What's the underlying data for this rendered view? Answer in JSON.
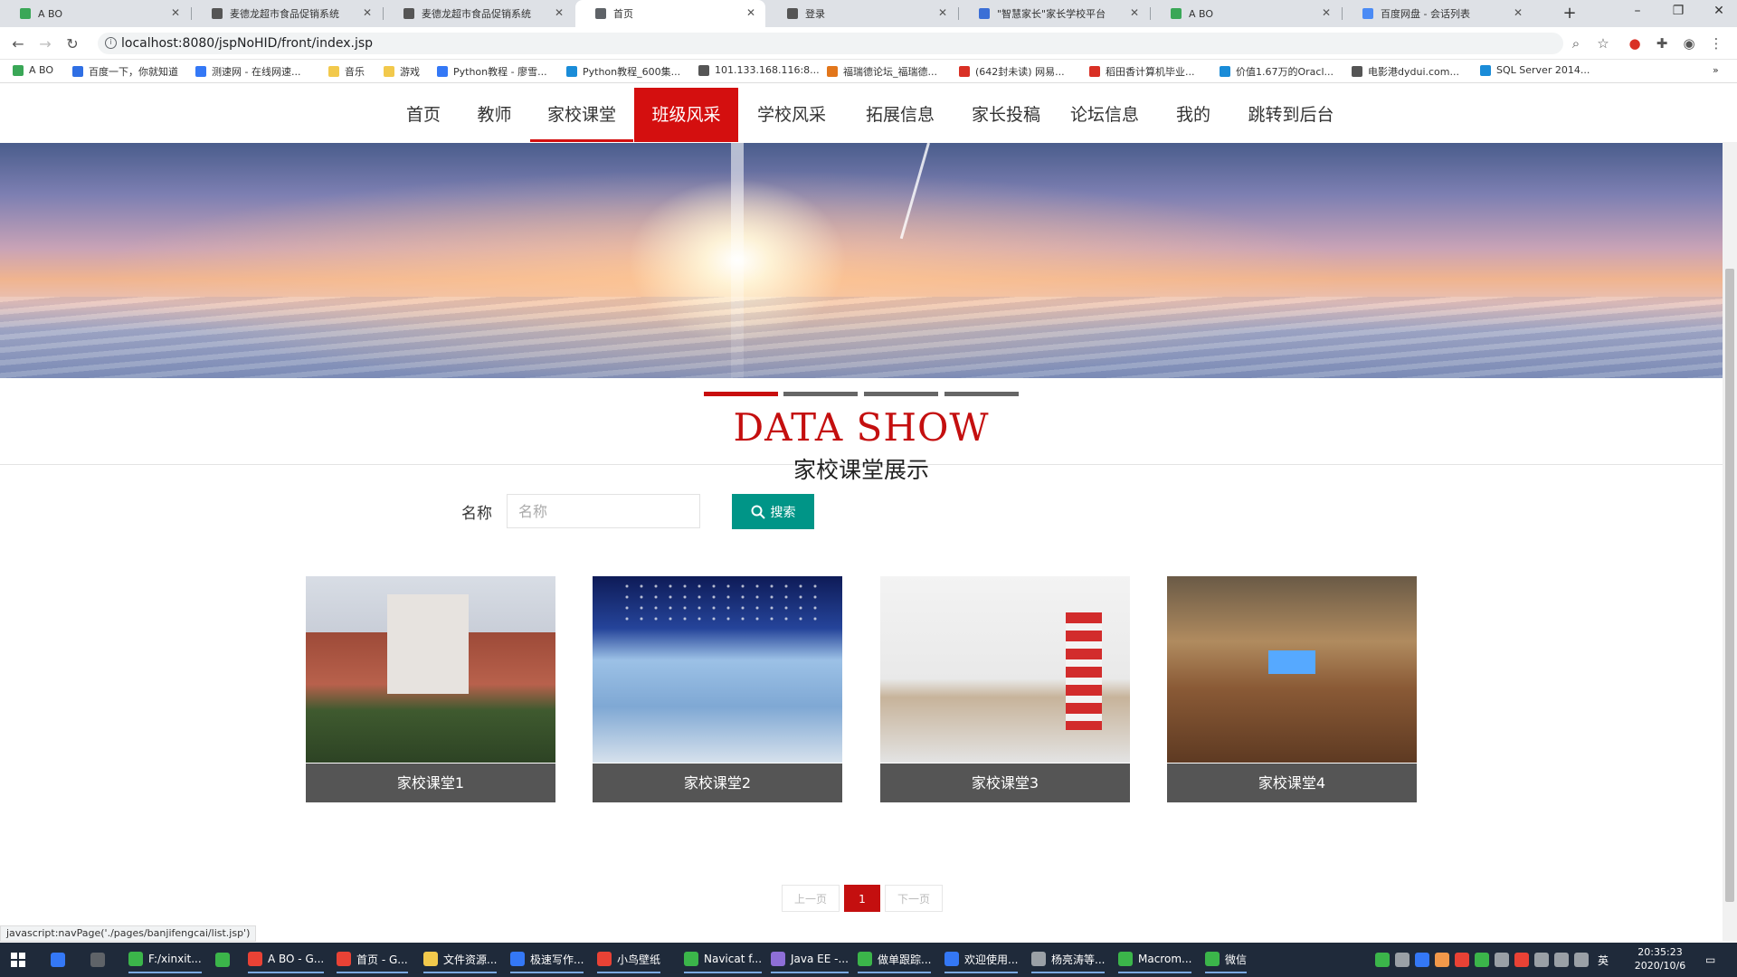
{
  "browser": {
    "tabs": [
      {
        "title": "A BO",
        "icon": "leaf-icon",
        "color": "#3aa757"
      },
      {
        "title": "麦德龙超市食品促销系统",
        "icon": "cart-icon",
        "color": "#555555"
      },
      {
        "title": "麦德龙超市食品促销系统",
        "icon": "cart-icon",
        "color": "#555555"
      },
      {
        "title": "首页",
        "icon": "globe-icon",
        "color": "#5f6368",
        "active": true
      },
      {
        "title": "登录",
        "icon": "login-icon",
        "color": "#555555"
      },
      {
        "title": "\"智慧家长\"家长学校平台",
        "icon": "shield-icon",
        "color": "#3b6fd6"
      },
      {
        "title": "A BO",
        "icon": "leaf-icon",
        "color": "#3aa757"
      },
      {
        "title": "百度网盘 - 会话列表",
        "icon": "cloud-icon",
        "color": "#4b8bf5"
      }
    ],
    "url": "localhost:8080/jspNoHID/front/index.jsp",
    "bookmarks": [
      {
        "label": "A BO",
        "color": "#3aa757"
      },
      {
        "label": "百度一下，你就知道",
        "color": "#2f6fe4"
      },
      {
        "label": "测速网 - 在线网速...",
        "color": "#3478f6"
      },
      {
        "label": "音乐",
        "color": "#f2c94c"
      },
      {
        "label": "游戏",
        "color": "#f2c94c"
      },
      {
        "label": "Python教程 - 廖雪...",
        "color": "#3478f6"
      },
      {
        "label": "Python教程_600集...",
        "color": "#1a8cd8"
      },
      {
        "label": "101.133.168.116:8...",
        "color": "#555555"
      },
      {
        "label": "福瑞德论坛_福瑞德...",
        "color": "#e2761b"
      },
      {
        "label": "(642封未读) 网易...",
        "color": "#d93025"
      },
      {
        "label": "稻田香计算机毕业...",
        "color": "#d93025"
      },
      {
        "label": "价值1.67万的Oracl...",
        "color": "#1a8cd8"
      },
      {
        "label": "电影港dydui.com...",
        "color": "#555555"
      },
      {
        "label": "SQL Server 2014...",
        "color": "#1a8cd8"
      }
    ]
  },
  "nav": {
    "items": [
      "首页",
      "教师",
      "家校课堂",
      "班级风采",
      "学校风采",
      "拓展信息",
      "家长投稿",
      "论坛信息",
      "我的",
      "跳转到后台"
    ],
    "active": "班级风采"
  },
  "section": {
    "title": "DATA SHOW",
    "subtitle": "家校课堂展示"
  },
  "search": {
    "label": "名称",
    "placeholder": "名称",
    "button": "搜索"
  },
  "cards": [
    "家校课堂1",
    "家校课堂2",
    "家校课堂3",
    "家校课堂4"
  ],
  "pagination": {
    "prev": "上一页",
    "current": "1",
    "next": "下一页"
  },
  "status_url": "javascript:navPage('./pages/banjifengcai/list.jsp')",
  "taskbar": {
    "apps": [
      {
        "label": "F:/xinxit...",
        "color": "#3bb54a"
      },
      {
        "label": "",
        "color": "#3bb54a"
      },
      {
        "label": "A BO - G...",
        "color": "#e94235"
      },
      {
        "label": "首页 - G...",
        "color": "#e94235"
      },
      {
        "label": "文件资源...",
        "color": "#f2c94c"
      },
      {
        "label": "极速写作...",
        "color": "#3478f6"
      },
      {
        "label": "小鸟壁纸",
        "color": "#e94235"
      },
      {
        "label": "Navicat f...",
        "color": "#3bb54a"
      },
      {
        "label": "Java EE -...",
        "color": "#8e6fd8"
      },
      {
        "label": "做单跟踪...",
        "color": "#3bb54a"
      },
      {
        "label": "欢迎使用...",
        "color": "#3478f6"
      },
      {
        "label": "杨亮涛等...",
        "color": "#9aa0a6"
      },
      {
        "label": "Macrom...",
        "color": "#3bb54a"
      },
      {
        "label": "微信",
        "color": "#3bb54a"
      }
    ],
    "tray_lang": "英",
    "time": "20:35:23",
    "date": "2020/10/6"
  }
}
